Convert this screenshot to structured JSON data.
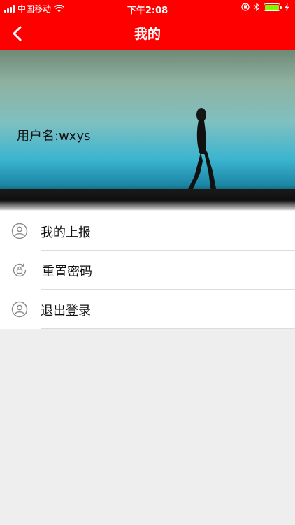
{
  "status_bar": {
    "carrier": "中国移动",
    "time": "下午2:08"
  },
  "nav": {
    "title": "我的",
    "back_icon": "chevron-left-icon"
  },
  "profile": {
    "username": "用户名:wxys"
  },
  "menu": {
    "items": [
      {
        "label": "我的上报",
        "icon": "user-circle-icon"
      },
      {
        "label": "重置密码",
        "icon": "lock-reset-icon"
      },
      {
        "label": "退出登录",
        "icon": "user-circle-icon"
      }
    ]
  },
  "colors": {
    "accent": "#ff0000",
    "background": "#eeeeee"
  }
}
